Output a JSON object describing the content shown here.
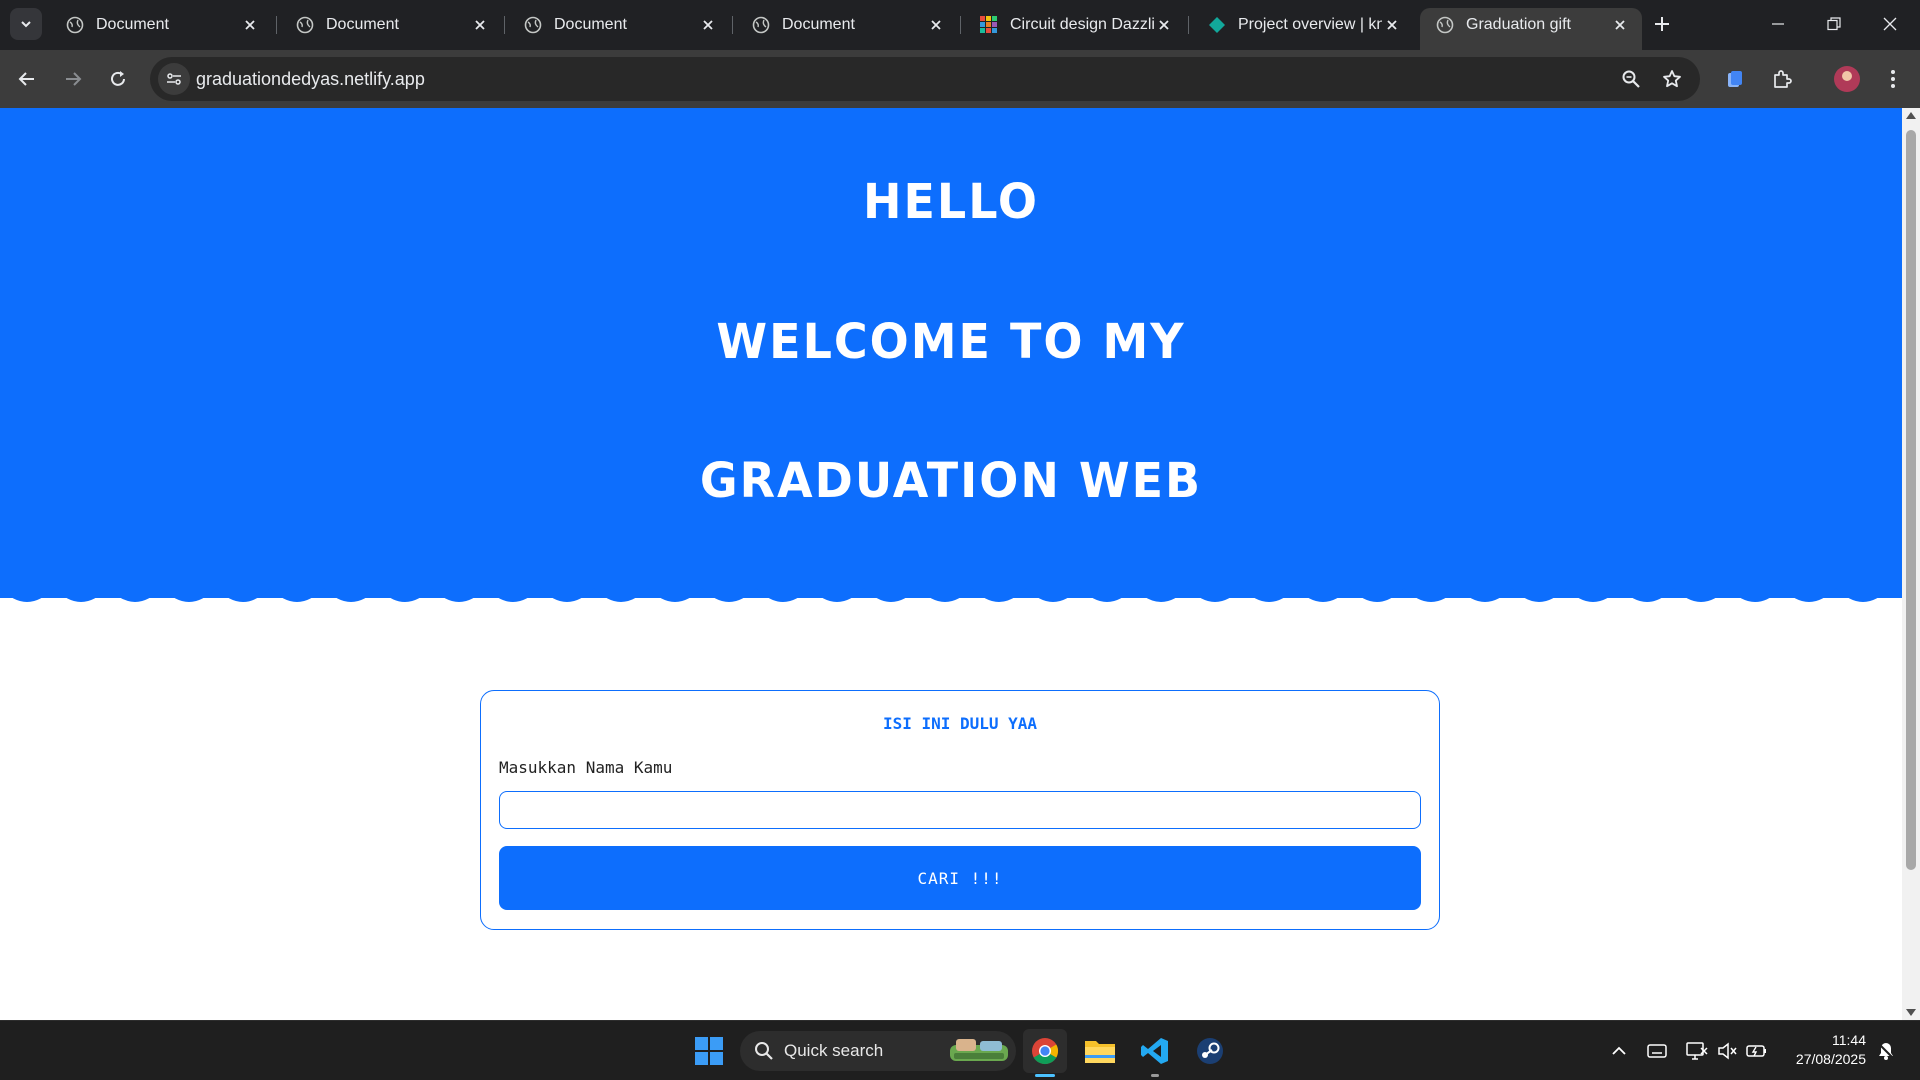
{
  "browser": {
    "tabs": [
      {
        "title": "Document",
        "icon": "globe-icon"
      },
      {
        "title": "Document",
        "icon": "globe-icon"
      },
      {
        "title": "Document",
        "icon": "globe-icon"
      },
      {
        "title": "Document",
        "icon": "globe-icon"
      },
      {
        "title": "Circuit design Dazzlin",
        "icon": "tinkercad-icon"
      },
      {
        "title": "Project overview | kn",
        "icon": "diamond-icon"
      },
      {
        "title": "Graduation gift",
        "icon": "globe-icon",
        "active": true
      }
    ],
    "url": "graduationdedyas.netlify.app"
  },
  "page": {
    "hero": {
      "line1": "HELLO",
      "line2": "WELCOME TO MY",
      "line3": "GRADUATION WEB"
    },
    "form": {
      "title": "ISI INI DULU YAA",
      "name_label": "Masukkan Nama Kamu",
      "name_value": "",
      "name_placeholder": "",
      "submit_label": "CARI !!!"
    }
  },
  "taskbar": {
    "search_label": "Quick search",
    "time": "11:44",
    "date": "27/08/2025"
  },
  "colors": {
    "brand_blue": "#0d6efd",
    "chrome_dark": "#202124",
    "toolbar": "#3c3c3c"
  }
}
